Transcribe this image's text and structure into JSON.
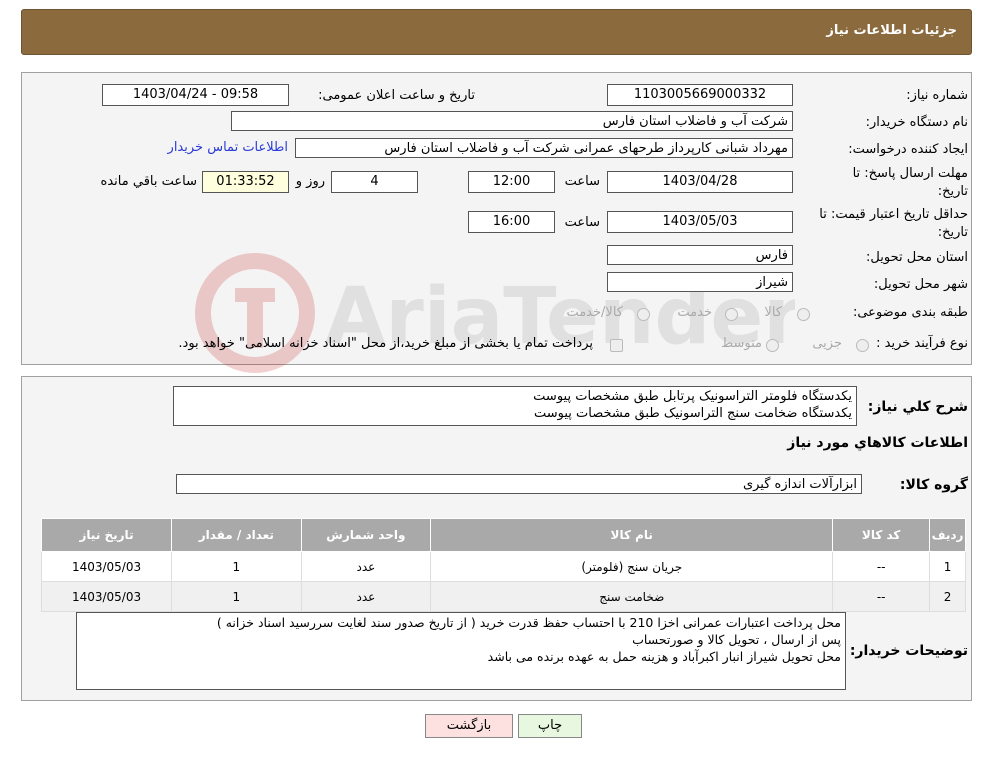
{
  "header": {
    "title": "جزئیات اطلاعات نیاز"
  },
  "form": {
    "need_number_label": "شماره نیاز:",
    "need_number": "1103005669000332",
    "announce_label": "تاریخ و ساعت اعلان عمومی:",
    "announce_value": "1403/04/24 - 09:58",
    "buyer_org_label": "نام دستگاه خریدار:",
    "buyer_org": "شرکت آب و فاضلاب استان فارس",
    "creator_label": "ایجاد کننده درخواست:",
    "creator": "مهرداد شبانی کارپرداز طرحهای عمرانی  شرکت آب و فاضلاب استان فارس",
    "contact_link": "اطلاعات تماس خریدار",
    "deadline_label_1": "مهلت ارسال پاسخ: تا",
    "deadline_label_2": "تاریخ:",
    "deadline_date": "1403/04/28",
    "time_label": "ساعت",
    "deadline_time": "12:00",
    "days_value": "4",
    "days_label": "روز و",
    "remaining_time": "01:33:52",
    "remaining_label": "ساعت باقي مانده",
    "validity_label_1": "حداقل تاریخ اعتبار قیمت: تا",
    "validity_label_2": "تاریخ:",
    "validity_date": "1403/05/03",
    "validity_time": "16:00",
    "province_label": "استان محل تحویل:",
    "province": "فارس",
    "city_label": "شهر محل تحویل:",
    "city": "شیراز",
    "category_label": "طبقه بندی موضوعی:",
    "category_options": [
      "کالا",
      "خدمت",
      "کالا/خدمت"
    ],
    "process_label": "نوع فرآیند خرید :",
    "process_options": [
      "جزیی",
      "متوسط"
    ],
    "process_note": "پرداخت تمام یا بخشی از مبلغ خرید،از محل \"اسناد خزانه اسلامی\" خواهد بود."
  },
  "details": {
    "desc_label": "شرح كلي نياز:",
    "desc_line1": "یکدستگاه فلومتر التراسونیک پرتابل طبق مشخصات پیوست",
    "desc_line2": "یکدستگاه ضخامت سنج التراسونیک طبق مشخصات پیوست",
    "goods_info_title": "اطلاعات كالاهاي مورد نياز",
    "group_label": "گروه کالا:",
    "group_value": "ابزارآلات اندازه گیری",
    "table": {
      "headers": [
        "ردیف",
        "کد کالا",
        "نام کالا",
        "واحد شمارش",
        "تعداد / مقدار",
        "تاریخ نیاز"
      ],
      "rows": [
        [
          "1",
          "--",
          "جریان سنج (فلومتر)",
          "عدد",
          "1",
          "1403/05/03"
        ],
        [
          "2",
          "--",
          "ضخامت سنج",
          "عدد",
          "1",
          "1403/05/03"
        ]
      ]
    },
    "buyer_notes_label": "توضیحات خریدار:",
    "buyer_notes_line1": "محل پرداخت اعتبارات عمرانی اخزا  210 با احتساب حفظ قدرت خرید ( از تاریخ صدور سند لغایت سررسید اسناد خزانه )",
    "buyer_notes_line2": "پس از ارسال ، تحویل کالا و صورتحساب",
    "buyer_notes_line3": "محل تحویل شیراز انبار اکبرآباد و هزینه حمل به عهده برنده می باشد"
  },
  "buttons": {
    "print": "چاپ",
    "back": "بازگشت"
  },
  "watermark": "AriaTender.neT",
  "colors": {
    "header_bg": "#8b6a3e",
    "link": "#2a3bd8",
    "table_header": "#a9a9a9",
    "print_btn": "#e8f8e0",
    "back_btn": "#fde0e0"
  }
}
